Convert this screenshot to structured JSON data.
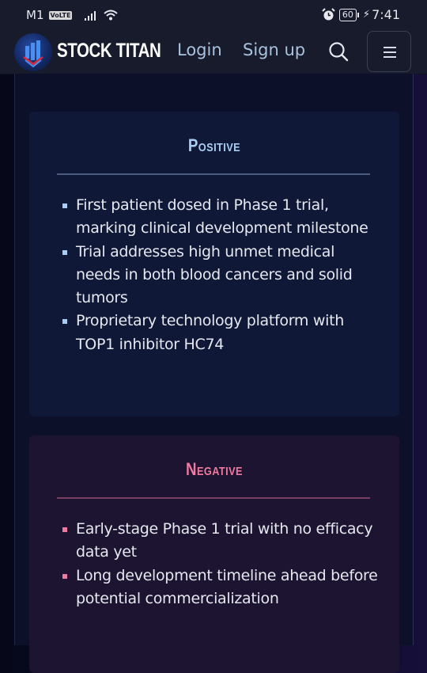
{
  "status_bar": {
    "carrier": "M1",
    "network_badge": "VoLTE",
    "battery": "60",
    "time": "7:41",
    "icons": [
      "signal-icon",
      "wifi-icon",
      "alarm-icon",
      "battery-icon",
      "charging-icon"
    ]
  },
  "navbar": {
    "brand": "STOCK TITAN",
    "login_label": "Login",
    "signup_label": "Sign up",
    "icons": [
      "logo-icon",
      "search-icon",
      "menu-icon"
    ]
  },
  "colors": {
    "positive_accent": "#a9cdf2",
    "negative_accent": "#f07aa0",
    "positive_card_bg": "#101838",
    "negative_card_bg": "#1c1430"
  },
  "positive": {
    "title": "Positive",
    "items": [
      "First patient dosed in Phase 1 trial, marking clinical development milestone",
      "Trial addresses high unmet medical needs in both blood cancers and solid tumors",
      "Proprietary technology platform with TOP1 inhibitor HC74"
    ]
  },
  "negative": {
    "title": "Negative",
    "items": [
      "Early-stage Phase 1 trial with no efficacy data yet",
      "Long development timeline ahead before potential commercialization"
    ]
  }
}
